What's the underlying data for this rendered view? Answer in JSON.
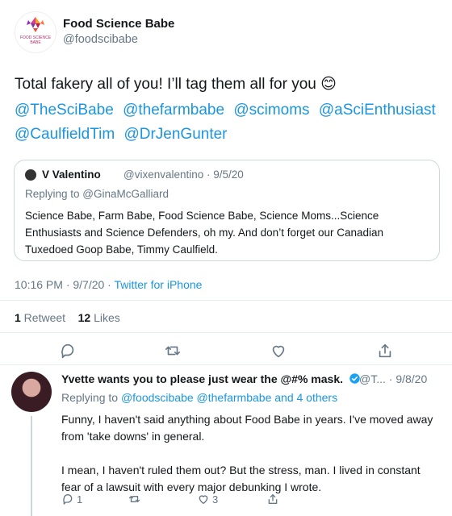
{
  "tweet": {
    "display_name": "Food Science Babe",
    "handle": "@foodscibabe",
    "avatar_text": [
      "FOOD SCIENCE",
      "BABE"
    ],
    "text": "Total fakery all of you! I’ll tag them all for you 😊",
    "mentions": [
      "@TheSciBabe",
      "@thefarmbabe",
      "@scimoms",
      "@aSciEnthusiast",
      "@CaulfieldTim",
      "@DrJenGunter"
    ],
    "time": "10:16 PM · 9/7/20 · ",
    "source": "Twitter for iPhone",
    "retweet_count": "1",
    "retweet_label": " Retweet",
    "like_count": "12",
    "like_label": " Likes"
  },
  "quote": {
    "display_name": "V Valentino",
    "meta": "@vixenvalentino · 9/5/20",
    "replying_prefix": "Replying to ",
    "replying_to": "@GinaMcGalliard",
    "text": "Science Babe, Farm Babe, Food Science Babe, Science Moms...Science Enthusiasts and Science Defenders, oh my. And don’t forget our Canadian Tuxedoed Goop Babe, Timmy Caulfield."
  },
  "reply": {
    "display_name": "Yvette wants you to please just wear the @#% mask.",
    "meta": "@T... · 9/8/20",
    "replying_prefix": "Replying to ",
    "replying_to": "@foodscibabe @thefarmbabe and 4 others",
    "paragraphs": [
      "Funny, I haven't said anything about Food Babe in years. I've moved away from 'take downs' in general.",
      "I mean, I haven't ruled them out? But the stress, man. I lived in constant fear of a lawsuit with every major debunking I wrote."
    ],
    "reply_count": "1",
    "like_count": "3"
  },
  "colors": {
    "link": "#1b95e0",
    "muted": "#657786",
    "verified": "#1da1f2"
  }
}
